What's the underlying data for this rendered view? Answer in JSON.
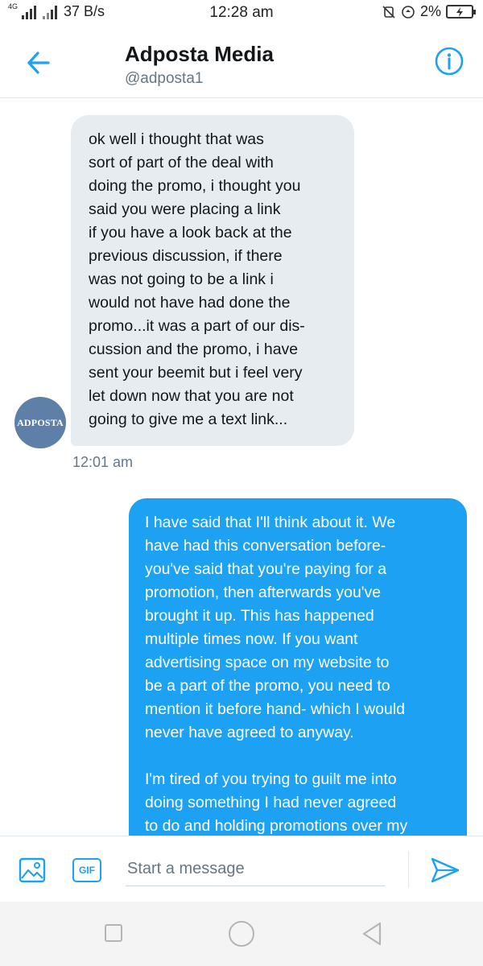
{
  "status_bar": {
    "network_tag": "4G",
    "speed": "37 B/s",
    "time": "12:28 am",
    "battery": "2%"
  },
  "header": {
    "title": "Adposta Media",
    "handle": "@adposta1",
    "back_icon": "arrow-left-icon",
    "info_icon": "info-icon",
    "accent_color": "#1da1f2"
  },
  "conversation": {
    "avatar_text": "ADPOSTA",
    "incoming": {
      "text": "ok well i thought that was\nsort of part of the deal with\ndoing the promo, i thought you\nsaid you were placing a link\nif you have a look back at the\nprevious discussion, if there\nwas not going to be a link i\nwould not have had done the\npromo...it was a part of our dis-\ncussion and the promo, i have\nsent your beemit but i feel very\nlet down now that you are not\ngoing to give me a text link...",
      "time": "12:01 am",
      "bubble_color": "#e6ecf0"
    },
    "outgoing": {
      "text": "I have said that I'll think about it. We\nhave had this conversation before-\nyou've said that you're paying for a\npromotion, then afterwards you've\nbrought it up. This has happened\nmultiple times now. If you want\nadvertising space on my website to\nbe a part of the promo, you need to\nmention it before hand- which I would\nnever have agreed to anyway.\n\nI'm tired of you trying to guilt me into\ndoing something I had never agreed\nto do and holding promotions over my",
      "bubble_color": "#1da1f2"
    }
  },
  "composer": {
    "placeholder": "Start a message",
    "gif_label": "GIF",
    "image_icon": "image-icon",
    "send_icon": "send-icon"
  },
  "navbar": {
    "recents_icon": "square-icon",
    "home_icon": "circle-icon",
    "back_icon": "triangle-back-icon"
  }
}
